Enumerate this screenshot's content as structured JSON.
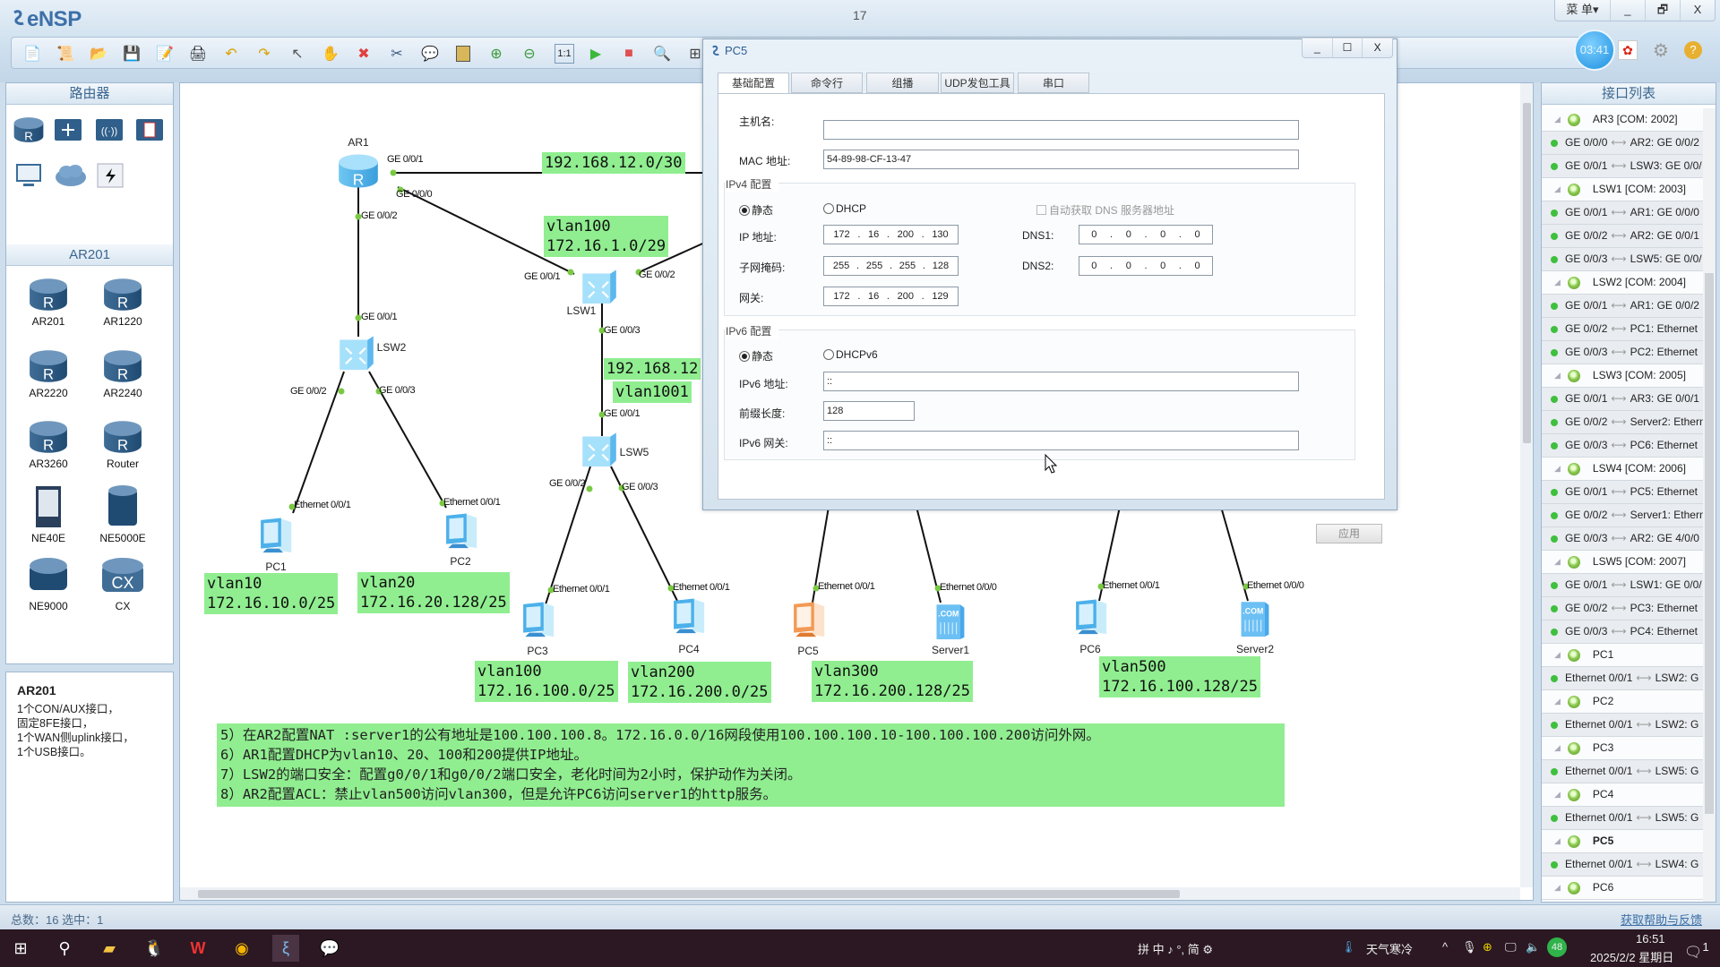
{
  "app": {
    "title": "eNSP",
    "document_title": "17",
    "menu_label": "菜 单▾",
    "minimize": "_",
    "restore": "🗗",
    "close": "X",
    "timer": "03:41"
  },
  "toolbar": {
    "icons": [
      "new-topology",
      "new-exam",
      "open",
      "save",
      "save-as",
      "print",
      "undo",
      "redo",
      "select",
      "pan",
      "delete",
      "delete-link",
      "text",
      "rectangle",
      "zoom-in",
      "zoom-out",
      "fit",
      "start",
      "stop",
      "capture",
      "topology"
    ]
  },
  "left_panel": {
    "category_title": "路由器",
    "category_icons": [
      "router-icon",
      "switch-icon",
      "wireless-icon",
      "firewall-icon",
      "pc-icon",
      "cloud-icon",
      "link-icon"
    ],
    "model_title": "AR201",
    "devices": [
      {
        "label": "AR201"
      },
      {
        "label": "AR1220"
      },
      {
        "label": "AR2220"
      },
      {
        "label": "AR2240"
      },
      {
        "label": "AR3260"
      },
      {
        "label": "Router"
      },
      {
        "label": "NE40E"
      },
      {
        "label": "NE5000E"
      },
      {
        "label": "NE9000"
      },
      {
        "label": "CX"
      }
    ],
    "description": {
      "title": "AR201",
      "text": "1个CON/AUX接口，\n固定8FE接口，\n1个WAN侧uplink接口，\n1个USB接口。"
    }
  },
  "status_bar": {
    "text": "总数：16  选中：1",
    "help_link": "获取帮助与反馈"
  },
  "topology": {
    "nodes": {
      "AR1": "AR1",
      "LSW1": "LSW1",
      "LSW2": "LSW2",
      "LSW5": "LSW5",
      "PC1": "PC1",
      "PC2": "PC2",
      "PC3": "PC3",
      "PC4": "PC4",
      "PC5": "PC5",
      "Server1": "Server1",
      "PC6": "PC6",
      "Server2": "Server2"
    },
    "ports": {
      "ar1_g001": "GE 0/0/1",
      "ar1_g000": "GE 0/0/0",
      "ar1_g002": "GE 0/0/2",
      "lsw1_g001": "GE 0/0/1",
      "lsw1_g002": "GE 0/0/2",
      "lsw1_g003": "GE 0/0/3",
      "lsw2_g001": "GE 0/0/1",
      "lsw2_g002": "GE 0/0/2",
      "lsw2_g003": "GE 0/0/3",
      "lsw5_g001": "GE 0/0/1",
      "lsw5_g002": "GE 0/0/2",
      "lsw5_g003": "GE 0/0/3",
      "pc1": "Ethernet 0/0/1",
      "pc2": "Ethernet 0/0/1",
      "pc3": "Ethernet 0/0/1",
      "pc4": "Ethernet 0/0/1",
      "pc5": "Ethernet 0/0/1",
      "server1": "Ethernet 0/0/0",
      "pc6": "Ethernet 0/0/1",
      "server2": "Ethernet 0/0/0"
    },
    "notes": {
      "wan": "192.168.12.0/30",
      "vlan100_core": "vlan100\n172.16.1.0/29",
      "lsw1_lsw5_net": "192.168.12",
      "vlan1001": "vlan1001",
      "vlan10": "vlan10\n172.16.10.0/25",
      "vlan20": "vlan20\n172.16.20.128/25",
      "vlan100": "vlan100\n172.16.100.0/25",
      "vlan200": "vlan200\n172.16.200.0/25",
      "vlan300": "vlan300\n172.16.200.128/25",
      "vlan500": "vlan500\n172.16.100.128/25"
    },
    "tasks": [
      "5）在AR2配置NAT :server1的公有地址是100.100.100.8。172.16.0.0/16网段使用100.100.100.10-100.100.100.200访问外网。",
      "6）AR1配置DHCP为vlan10、20、100和200提供IP地址。",
      "7）LSW2的端口安全：配置g0/0/1和g0/0/2端口安全，老化时间为2小时，保护动作为关闭。",
      "8）AR2配置ACL：禁止vlan500访问vlan300，但是允许PC6访问server1的http服务。"
    ]
  },
  "pc_window": {
    "title": "PC5",
    "tabs": [
      "基础配置",
      "命令行",
      "组播",
      "UDP发包工具",
      "串口"
    ],
    "active_tab": "基础配置",
    "hostname_label": "主机名:",
    "hostname_value": "",
    "mac_label": "MAC 地址:",
    "mac_value": "54-89-98-CF-13-47",
    "ipv4": {
      "group_label": "IPv4 配置",
      "static_label": "静态",
      "dhcp_label": "DHCP",
      "mode": "static",
      "auto_dns_label": "自动获取 DNS 服务器地址",
      "auto_dns_checked": false,
      "ip_label": "IP 地址:",
      "ip": [
        "172",
        "16",
        "200",
        "130"
      ],
      "mask_label": "子网掩码:",
      "mask": [
        "255",
        "255",
        "255",
        "128"
      ],
      "gateway_label": "网关:",
      "gateway": [
        "172",
        "16",
        "200",
        "129"
      ],
      "dns1_label": "DNS1:",
      "dns1": [
        "0",
        "0",
        "0",
        "0"
      ],
      "dns2_label": "DNS2:",
      "dns2": [
        "0",
        "0",
        "0",
        "0"
      ]
    },
    "ipv6": {
      "group_label": "IPv6 配置",
      "static_label": "静态",
      "dhcp_label": "DHCPv6",
      "mode": "static",
      "addr_label": "IPv6 地址:",
      "addr": "::",
      "prefix_label": "前缀长度:",
      "prefix": "128",
      "gateway_label": "IPv6 网关:",
      "gateway": "::"
    },
    "apply_label": "应用"
  },
  "interface_list": {
    "title": "接口列表",
    "selected": "PC5",
    "rows": [
      {
        "type": "device",
        "label": "AR3 [COM: 2002]"
      },
      {
        "type": "link",
        "local": "GE 0/0/0",
        "remote": "AR2: GE 0/0/2"
      },
      {
        "type": "link",
        "local": "GE 0/0/1",
        "remote": "LSW3: GE 0/0/"
      },
      {
        "type": "device",
        "label": "LSW1 [COM: 2003]"
      },
      {
        "type": "link",
        "local": "GE 0/0/1",
        "remote": "AR1: GE 0/0/0"
      },
      {
        "type": "link",
        "local": "GE 0/0/2",
        "remote": "AR2: GE 0/0/1"
      },
      {
        "type": "link",
        "local": "GE 0/0/3",
        "remote": "LSW5: GE 0/0/"
      },
      {
        "type": "device",
        "label": "LSW2 [COM: 2004]"
      },
      {
        "type": "link",
        "local": "GE 0/0/1",
        "remote": "AR1: GE 0/0/2"
      },
      {
        "type": "link",
        "local": "GE 0/0/2",
        "remote": "PC1: Ethernet"
      },
      {
        "type": "link",
        "local": "GE 0/0/3",
        "remote": "PC2: Ethernet"
      },
      {
        "type": "device",
        "label": "LSW3 [COM: 2005]"
      },
      {
        "type": "link",
        "local": "GE 0/0/1",
        "remote": "AR3: GE 0/0/1"
      },
      {
        "type": "link",
        "local": "GE 0/0/2",
        "remote": "Server2: Ethern"
      },
      {
        "type": "link",
        "local": "GE 0/0/3",
        "remote": "PC6: Ethernet"
      },
      {
        "type": "device",
        "label": "LSW4 [COM: 2006]"
      },
      {
        "type": "link",
        "local": "GE 0/0/1",
        "remote": "PC5: Ethernet"
      },
      {
        "type": "link",
        "local": "GE 0/0/2",
        "remote": "Server1: Ethern"
      },
      {
        "type": "link",
        "local": "GE 0/0/3",
        "remote": "AR2: GE 4/0/0"
      },
      {
        "type": "device",
        "label": "LSW5 [COM: 2007]"
      },
      {
        "type": "link",
        "local": "GE 0/0/1",
        "remote": "LSW1: GE 0/0/"
      },
      {
        "type": "link",
        "local": "GE 0/0/2",
        "remote": "PC3: Ethernet"
      },
      {
        "type": "link",
        "local": "GE 0/0/3",
        "remote": "PC4: Ethernet"
      },
      {
        "type": "device",
        "label": "PC1"
      },
      {
        "type": "link",
        "local": "Ethernet 0/0/1",
        "remote": "LSW2: G"
      },
      {
        "type": "device",
        "label": "PC2"
      },
      {
        "type": "link",
        "local": "Ethernet 0/0/1",
        "remote": "LSW2: G"
      },
      {
        "type": "device",
        "label": "PC3"
      },
      {
        "type": "link",
        "local": "Ethernet 0/0/1",
        "remote": "LSW5: G"
      },
      {
        "type": "device",
        "label": "PC4"
      },
      {
        "type": "link",
        "local": "Ethernet 0/0/1",
        "remote": "LSW5: G"
      },
      {
        "type": "device",
        "label": "PC5"
      },
      {
        "type": "link",
        "local": "Ethernet 0/0/1",
        "remote": "LSW4: G"
      },
      {
        "type": "device",
        "label": "PC6"
      }
    ]
  },
  "taskbar": {
    "apps": [
      "windows-start",
      "search",
      "file-explorer",
      "qq",
      "wps",
      "chrome",
      "ensp",
      "wechat"
    ],
    "ime": "拼 中 ♪ °, 简 ⚙",
    "weather": "天气寒冷",
    "battery_badge": "48",
    "time": "16:51",
    "date": "2025/2/2 星期日",
    "notifications": "1"
  },
  "colors": {
    "note_bg": "#90ee90",
    "port_dot": "#7ac943",
    "link_up": "#3fbf3f",
    "taskbar": "#2b1822",
    "accent": "#3d6fa8"
  }
}
